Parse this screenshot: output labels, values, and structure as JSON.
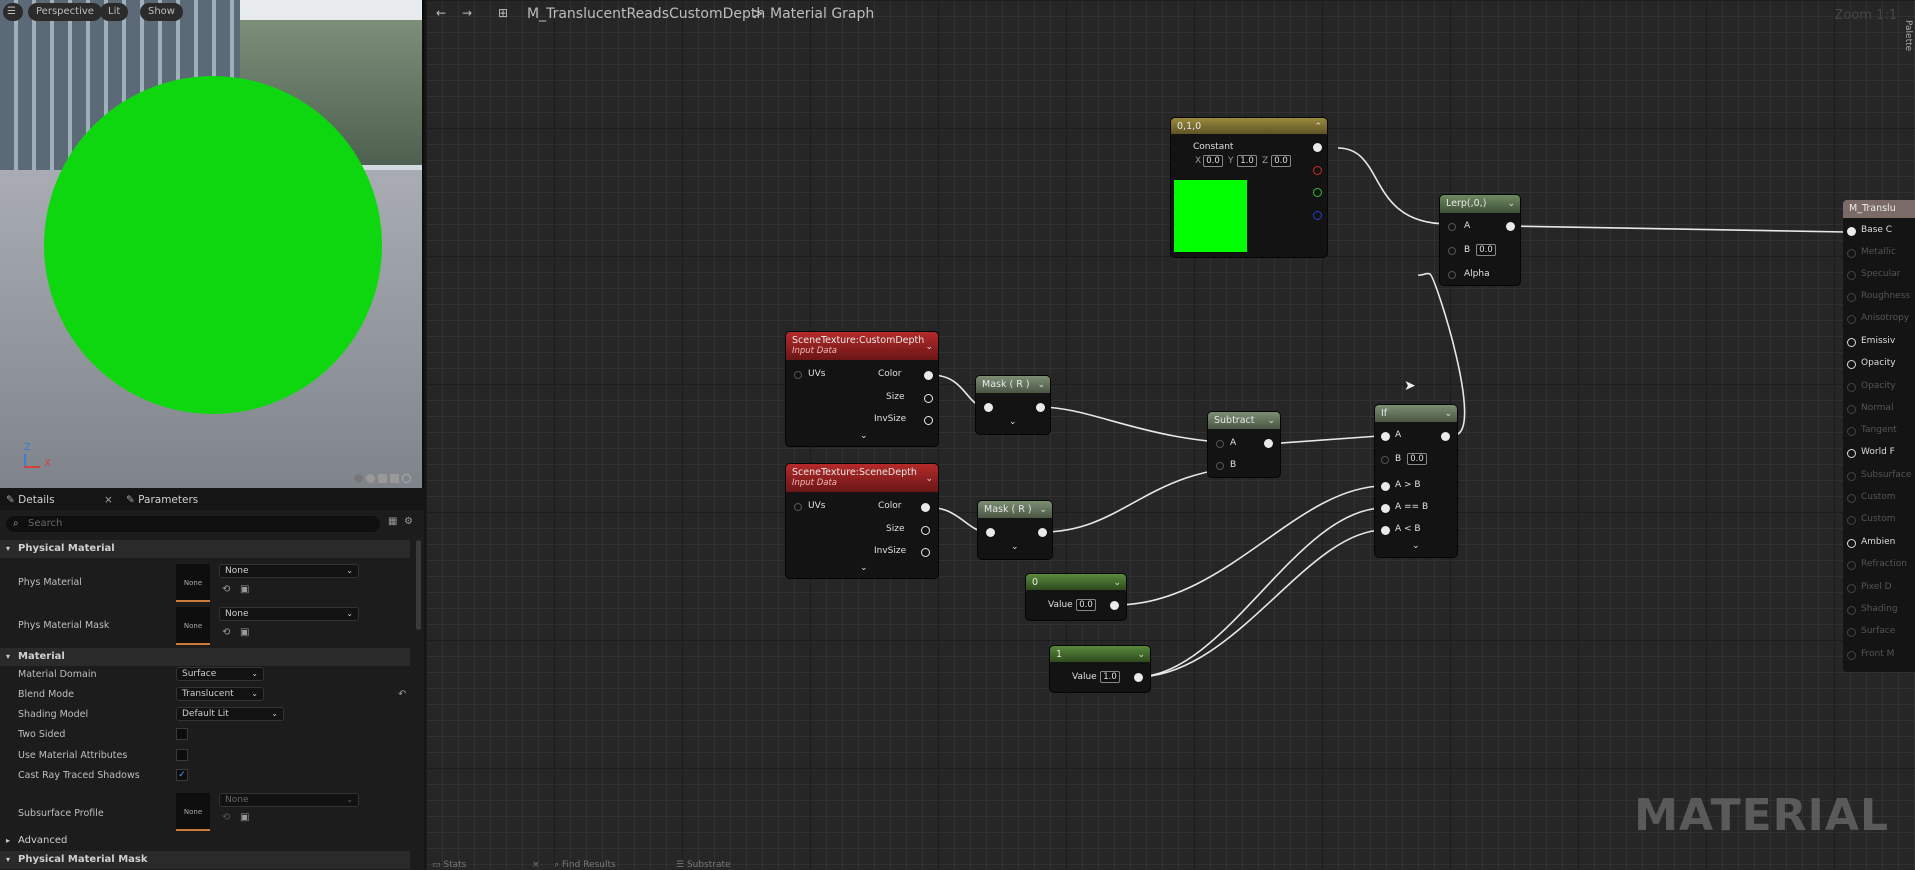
{
  "viewport": {
    "buttons": [
      "Perspective",
      "Lit",
      "Show"
    ],
    "axis_z": "Z",
    "axis_x": "X",
    "preview_color": "#0fd70f"
  },
  "details": {
    "tab_details": "Details",
    "tab_parameters": "Parameters",
    "search_placeholder": "Search",
    "sections": {
      "physical_material": "Physical Material",
      "material": "Material",
      "advanced": "Advanced",
      "physical_material_mask": "Physical Material Mask"
    },
    "phys_material": {
      "label": "Phys Material",
      "thumb": "None",
      "value": "None"
    },
    "phys_material_mask": {
      "label": "Phys Material Mask",
      "thumb": "None",
      "value": "None"
    },
    "material_domain": {
      "label": "Material Domain",
      "value": "Surface"
    },
    "blend_mode": {
      "label": "Blend Mode",
      "value": "Translucent"
    },
    "shading_model": {
      "label": "Shading Model",
      "value": "Default Lit"
    },
    "two_sided": {
      "label": "Two Sided",
      "checked": false
    },
    "use_material_attributes": {
      "label": "Use Material Attributes",
      "checked": false
    },
    "cast_ray_traced_shadows": {
      "label": "Cast Ray Traced Shadows",
      "checked": true,
      "mark": "✓"
    },
    "subsurface_profile": {
      "label": "Subsurface Profile",
      "thumb": "None",
      "value": "None"
    }
  },
  "graph": {
    "breadcrumb_material": "M_TranslucentReadsCustomDepth",
    "breadcrumb_sep": ">",
    "breadcrumb_graph": "Material Graph",
    "zoom": "Zoom 1:1",
    "watermark": "MATERIAL",
    "side_tab": "Palette",
    "bottom_tabs": [
      "Stats",
      "Find Results",
      "Substrate"
    ]
  },
  "nodes": {
    "constant": {
      "title": "0,1,0",
      "label": "Constant",
      "x_label": "X",
      "x_value": "0.0",
      "y_label": "Y",
      "y_value": "1.0",
      "z_label": "Z",
      "z_value": "0.0",
      "swatch": "#00ff00"
    },
    "lerp": {
      "title": "Lerp(,0,)",
      "pin_a": "A",
      "pin_b": "B",
      "b_value": "0.0",
      "pin_alpha": "Alpha"
    },
    "scene_custom": {
      "title": "SceneTexture:CustomDepth",
      "subtitle": "Input Data",
      "pin_uvs": "UVs",
      "pin_color": "Color",
      "pin_size": "Size",
      "pin_invsize": "InvSize"
    },
    "scene_depth": {
      "title": "SceneTexture:SceneDepth",
      "subtitle": "Input Data",
      "pin_uvs": "UVs",
      "pin_color": "Color",
      "pin_size": "Size",
      "pin_invsize": "InvSize"
    },
    "mask1": {
      "title": "Mask ( R )"
    },
    "mask2": {
      "title": "Mask ( R )"
    },
    "subtract": {
      "title": "Subtract",
      "pin_a": "A",
      "pin_b": "B"
    },
    "if": {
      "title": "If",
      "pin_a": "A",
      "pin_b": "B",
      "b_value": "0.0",
      "pin_agb": "A > B",
      "pin_aeb": "A == B",
      "pin_alb": "A < B"
    },
    "const0": {
      "title": "0",
      "label": "Value",
      "value": "0.0"
    },
    "const1": {
      "title": "1",
      "label": "Value",
      "value": "1.0"
    },
    "output": {
      "title": "M_Translu",
      "pins": [
        "Base C",
        "Metallic",
        "Specular",
        "Roughness",
        "Anisotropy",
        "Emissiv",
        "Opacity",
        "Opacity",
        "Normal",
        "Tangent",
        "World F",
        "Subsurface",
        "Custom",
        "Custom",
        "Ambien",
        "Refraction",
        "Pixel D",
        "Shading",
        "Surface",
        "Front M"
      ]
    }
  }
}
